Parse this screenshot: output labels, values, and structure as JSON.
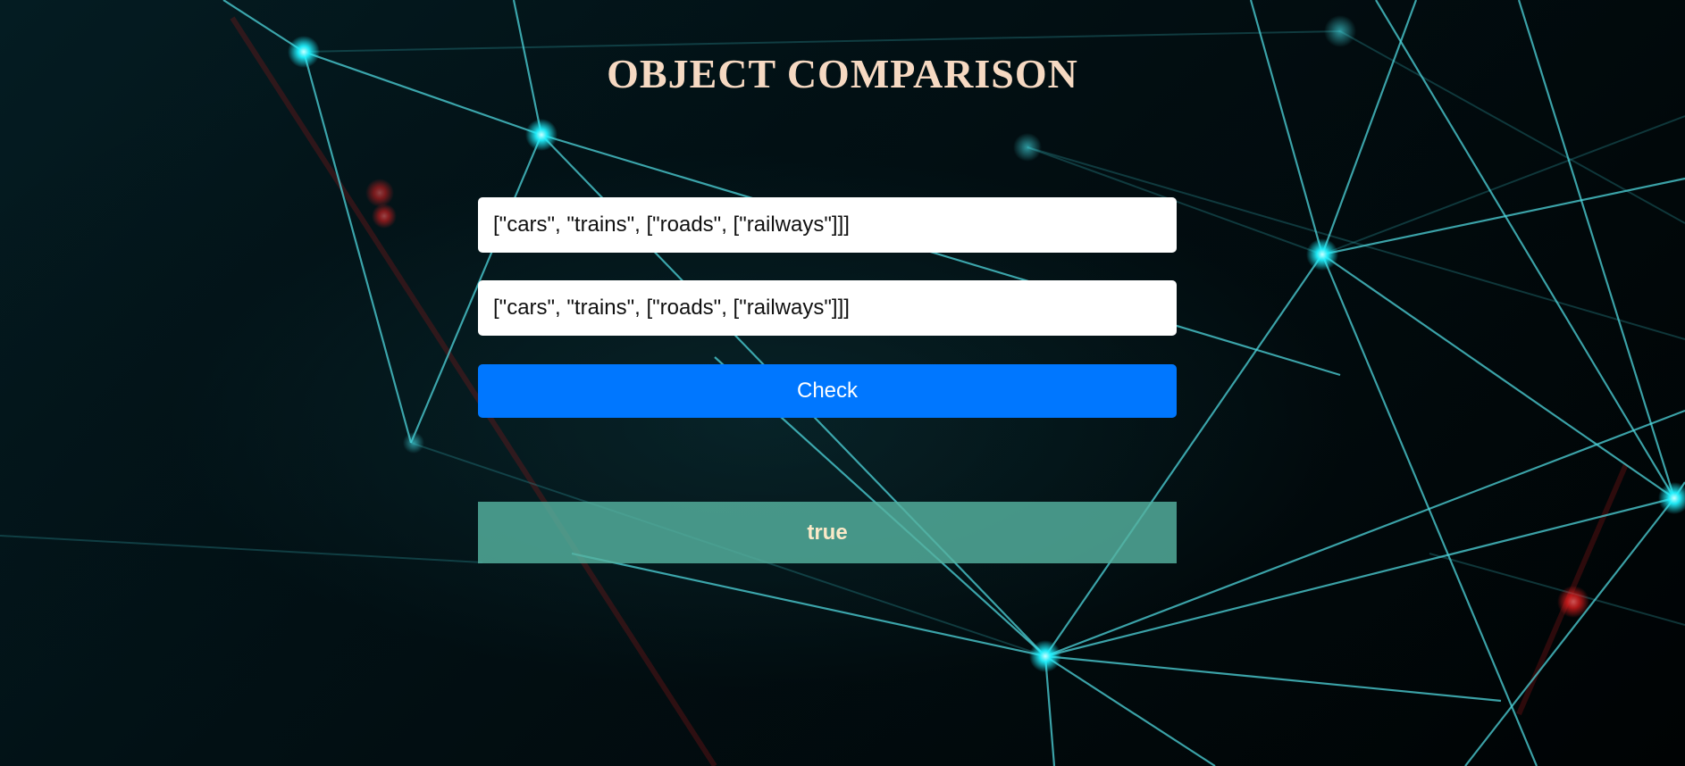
{
  "page": {
    "title": "OBJECT COMPARISON"
  },
  "form": {
    "first_input_value": "[\"cars\", \"trains\", [\"roads\", [\"railways\"]]]",
    "second_input_value": "[\"cars\", \"trains\", [\"roads\", [\"railways\"]]]",
    "check_label": "Check"
  },
  "result": {
    "value": "true"
  },
  "colors": {
    "title": "#f6d9c2",
    "button": "#0077ff",
    "result_background": "#56b2a0",
    "result_text": "#fbe9c8",
    "network_line": "#4fd6dc",
    "network_node": "#1ff3ff",
    "accent_red": "#ff2b2b"
  }
}
